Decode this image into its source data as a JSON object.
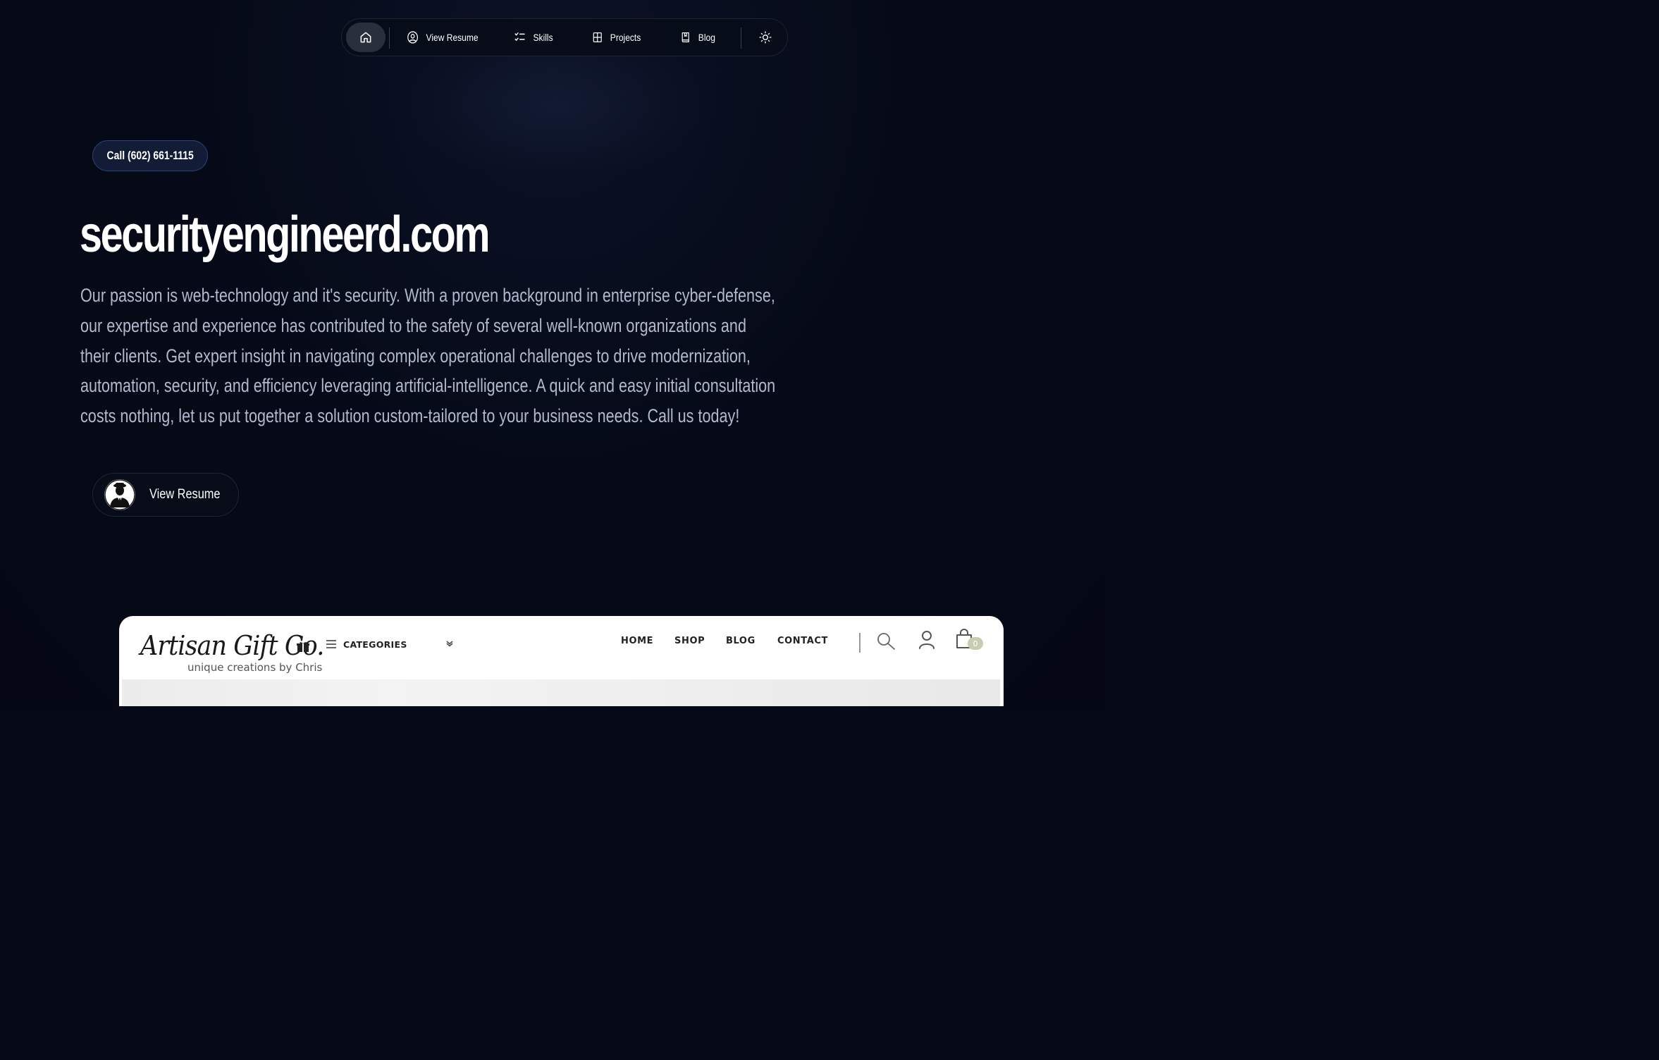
{
  "nav": {
    "home_label": "",
    "items": [
      {
        "label": "View Resume",
        "icon": "user-circle-icon"
      },
      {
        "label": "Skills",
        "icon": "checklist-icon"
      },
      {
        "label": "Projects",
        "icon": "grid-icon"
      },
      {
        "label": "Blog",
        "icon": "book-icon"
      }
    ],
    "theme_icon": "sun-icon"
  },
  "hero": {
    "call_label": "Call (602) 661-1115",
    "title": "securityengineerd.com",
    "description_lines": [
      "Our passion is web-technology and it's security. With a proven background in enterprise cyber-defense,",
      "our expertise and experience has contributed to the safety of several well-known organizations and",
      "their clients. Get expert insight in navigating complex operational challenges to drive modernization,",
      "automation, security, and efficiency leveraging artificial-intelligence. A quick and easy initial consultation",
      "costs nothing, let us put together a solution custom-tailored to your business needs. Call us today!"
    ],
    "resume_button": "View Resume"
  },
  "preview": {
    "logo_text": "Artisan Gift Co.",
    "logo_tagline": "unique creations by Chris",
    "categories_label": "CATEGORIES",
    "nav": [
      "HOME",
      "SHOP",
      "BLOG",
      "CONTACT"
    ],
    "cart_count": "0"
  },
  "colors": {
    "background": "#050915",
    "call_pill": "#121c36",
    "body_text": "#b3b9cd",
    "cart_badge": "#c8cdb0"
  }
}
